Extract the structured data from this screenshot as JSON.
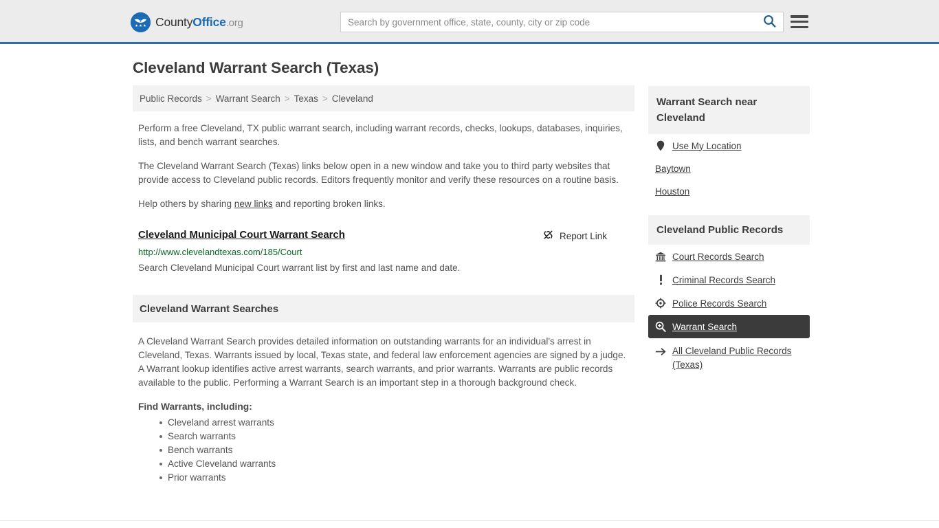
{
  "header": {
    "logo": {
      "text_part1": "County",
      "text_part2": "Office",
      "text_part3": ".org",
      "icon": "eagle-stars-seal-icon"
    },
    "search": {
      "placeholder": "Search by government office, state, county, city or zip code",
      "value": "",
      "button_icon": "search-icon"
    },
    "menu_icon": "hamburger-menu-icon"
  },
  "page_title": "Cleveland Warrant Search (Texas)",
  "breadcrumb": {
    "items": [
      {
        "label": "Public Records"
      },
      {
        "label": "Warrant Search"
      },
      {
        "label": "Texas"
      },
      {
        "label": "Cleveland"
      }
    ],
    "separator": ">"
  },
  "main": {
    "paragraphs": [
      "Perform a free Cleveland, TX public warrant search, including warrant records, checks, lookups, databases, inquiries, lists, and bench warrant searches.",
      "The Cleveland Warrant Search (Texas) links below open in a new window and take you to third party websites that provide access to Cleveland public records. Editors frequently monitor and verify these resources on a routine basis."
    ],
    "share_prefix": "Help others by sharing ",
    "share_link": "new links",
    "share_suffix": " and reporting broken links.",
    "result": {
      "title": "Cleveland Municipal Court Warrant Search",
      "url": "http://www.clevelandtexas.com/185/Court",
      "description": "Search Cleveland Municipal Court warrant list by first and last name and date.",
      "report_label": "Report Link",
      "report_icon": "broken-link-icon"
    },
    "section": {
      "heading": "Cleveland Warrant Searches",
      "body": "A Cleveland Warrant Search provides detailed information on outstanding warrants for an individual's arrest in Cleveland, Texas. Warrants issued by local, Texas state, and federal law enforcement agencies are signed by a judge. A Warrant lookup identifies active arrest warrants, search warrants, and prior warrants. Warrants are public records available to the public. Performing a Warrant Search is an important step in a thorough background check.",
      "list_heading": "Find Warrants, including:",
      "list_items": [
        "Cleveland arrest warrants",
        "Search warrants",
        "Bench warrants",
        "Active Cleveland warrants",
        "Prior warrants"
      ]
    }
  },
  "sidebar": {
    "nearby": {
      "heading": "Warrant Search near Cleveland",
      "items": [
        {
          "label": "Use My Location",
          "icon": "map-pin-icon"
        },
        {
          "label": "Baytown",
          "icon": ""
        },
        {
          "label": "Houston",
          "icon": ""
        }
      ]
    },
    "records": {
      "heading": "Cleveland Public Records",
      "items": [
        {
          "label": "Court Records Search",
          "icon": "courthouse-icon",
          "active": false
        },
        {
          "label": "Criminal Records Search",
          "icon": "exclamation-icon",
          "active": false
        },
        {
          "label": "Police Records Search",
          "icon": "police-badge-icon",
          "active": false
        },
        {
          "label": "Warrant Search",
          "icon": "magnifier-plus-icon",
          "active": true
        },
        {
          "label": "All Cleveland Public Records (Texas)",
          "icon": "arrow-right-icon",
          "active": false
        }
      ]
    }
  },
  "colors": {
    "brand_blue": "#1b6cb5",
    "header_bg": "#ececec",
    "header_border": "#2e6da4",
    "panel_bg": "#f2f2f2",
    "active_bg": "#3b3b3b",
    "url_green": "#0b6623",
    "body_text": "#555555"
  }
}
